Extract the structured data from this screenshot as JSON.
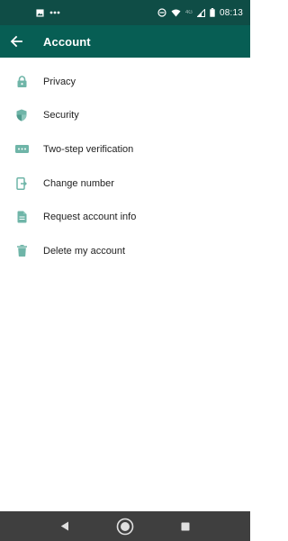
{
  "status_bar": {
    "time": "08:13",
    "network": "4G"
  },
  "header": {
    "title": "Account",
    "back_icon": "arrow-left-icon"
  },
  "menu": {
    "items": [
      {
        "label": "Privacy",
        "icon": "lock-icon"
      },
      {
        "label": "Security",
        "icon": "shield-icon"
      },
      {
        "label": "Two-step verification",
        "icon": "dots-pin-icon"
      },
      {
        "label": "Change number",
        "icon": "phone-swap-icon"
      },
      {
        "label": "Request account info",
        "icon": "document-icon"
      },
      {
        "label": "Delete my account",
        "icon": "trash-icon"
      }
    ]
  },
  "colors": {
    "status_bar": "#0f4d46",
    "app_bar": "#075e54",
    "icon_teal": "#6fb5a8",
    "nav_bar": "#3f3f3f"
  },
  "nav": {
    "buttons": [
      "back-triangle-icon",
      "home-circle-icon",
      "recents-square-icon"
    ]
  }
}
